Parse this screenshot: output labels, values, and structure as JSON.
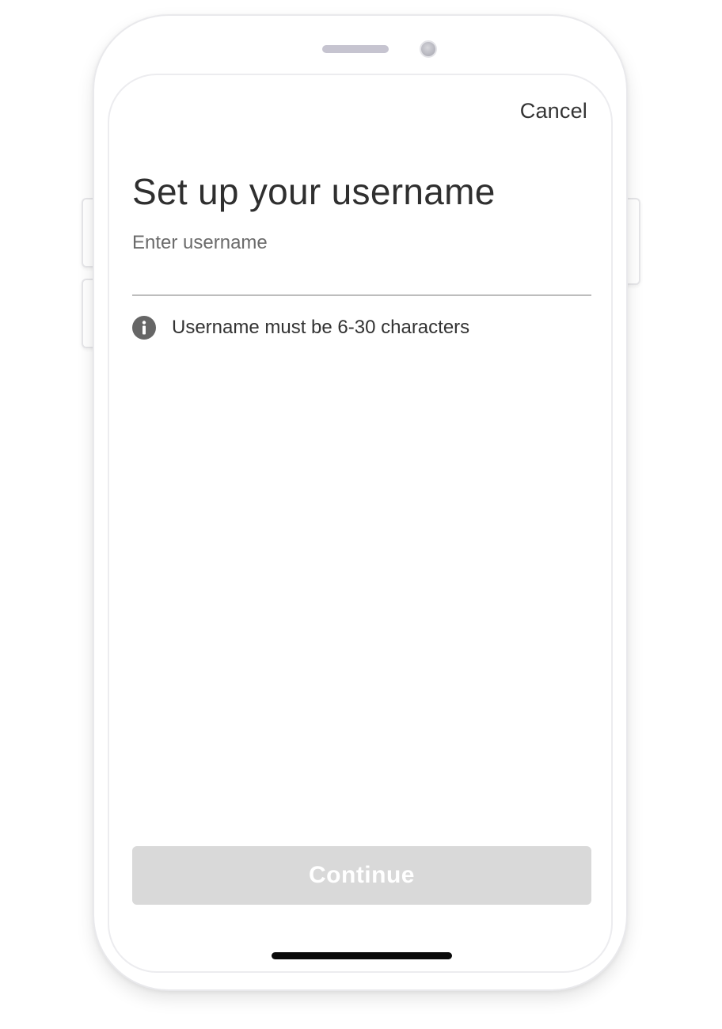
{
  "header": {
    "cancel_label": "Cancel"
  },
  "main": {
    "title": "Set up your username",
    "field_label": "Enter username",
    "input_value": "",
    "hint_icon": "info-icon",
    "hint_text": "Username must be 6-30 characters"
  },
  "footer": {
    "continue_label": "Continue",
    "continue_disabled": true
  },
  "colors": {
    "button_disabled_bg": "#d9d9d9",
    "button_disabled_text": "#ffffff",
    "text_primary": "#2f2f2f",
    "text_secondary": "#6b6b6b"
  }
}
